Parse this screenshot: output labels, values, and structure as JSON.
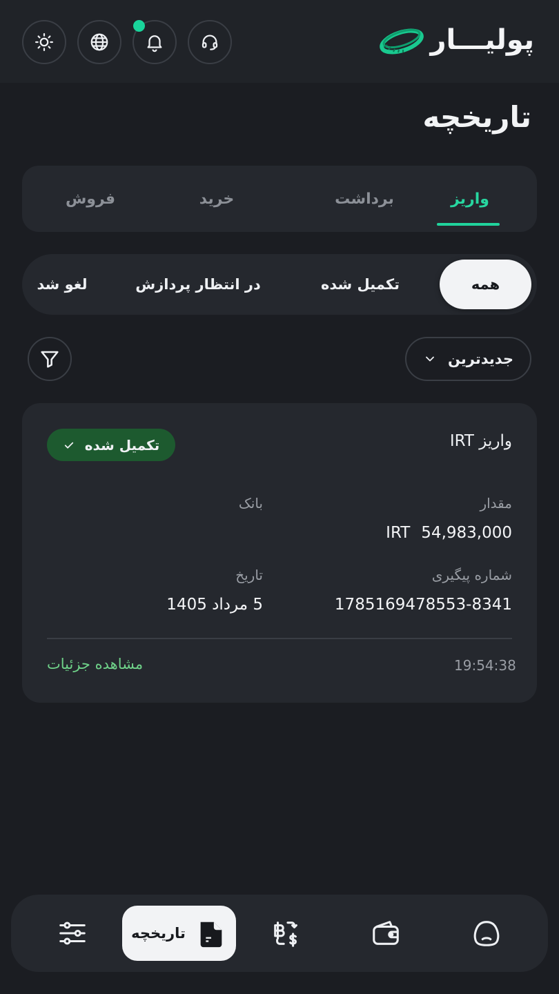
{
  "header": {
    "logo_text": "پولیـــار",
    "icons": [
      "theme-sun-icon",
      "globe-icon",
      "bell-icon",
      "headset-icon"
    ],
    "notification_dot_color": "#19d49b"
  },
  "page": {
    "title": "تاریخچه"
  },
  "tabs": [
    {
      "label": "واریز",
      "active": true
    },
    {
      "label": "برداشت",
      "active": false
    },
    {
      "label": "خرید",
      "active": false
    },
    {
      "label": "فروش",
      "active": false
    }
  ],
  "status_filters": [
    {
      "label": "همه",
      "active": true
    },
    {
      "label": "تکمیل شده",
      "active": false
    },
    {
      "label": "در انتظار پردازش",
      "active": false
    },
    {
      "label": "لغو شد",
      "active": false
    }
  ],
  "sort": {
    "label": "جدیدترین"
  },
  "transaction": {
    "title": "واریز IRT",
    "status": "تکمیل شده",
    "amount_label": "مقدار",
    "amount": "54,983,000",
    "currency": "IRT",
    "bank_label": "بانک",
    "bank_value": "",
    "tracking_label": "شماره پیگیری",
    "tracking_number": "1785169478553-8341",
    "date_label": "تاریخ",
    "date": "5 مرداد 1405",
    "time": "19:54:38",
    "details_link": "مشاهده جزئیات"
  },
  "bottom_nav": {
    "items": [
      "home-icon",
      "wallet-icon",
      "exchange-icon",
      "history-icon",
      "settings-sliders-icon"
    ],
    "active_label": "تاریخچه"
  },
  "colors": {
    "accent": "#20d39c",
    "success_badge": "#1d5a2f",
    "link": "#6fd289"
  }
}
